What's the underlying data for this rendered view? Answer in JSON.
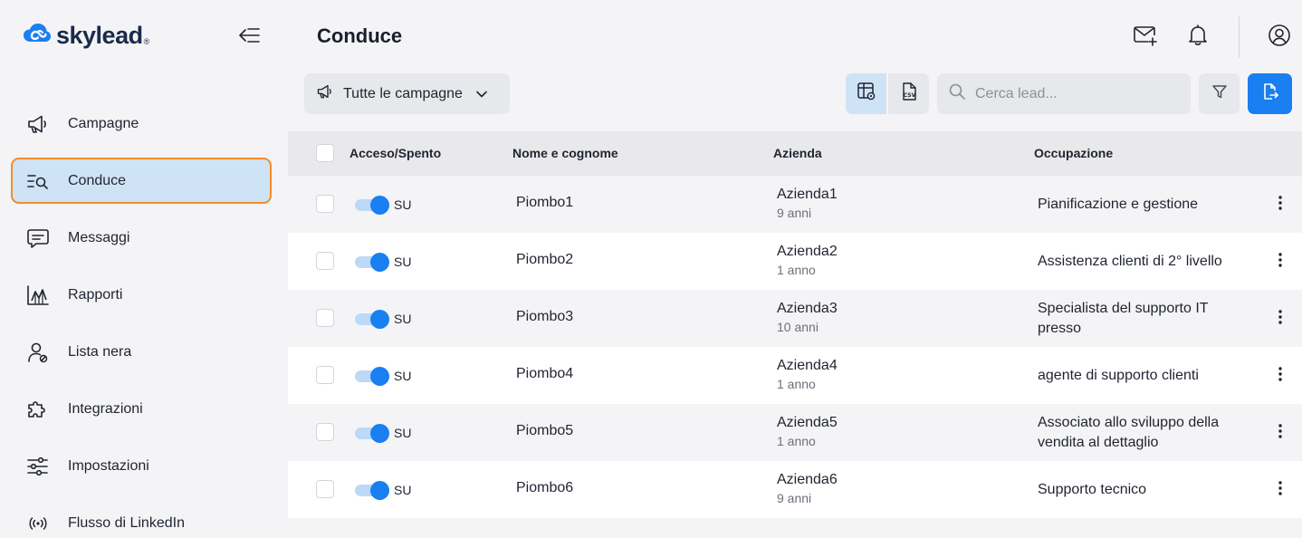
{
  "brand": {
    "name": "skylead",
    "mark": "®",
    "accent": "#1a7ff0"
  },
  "sidebar": {
    "items": [
      {
        "label": "Campagne",
        "icon": "megaphone-icon"
      },
      {
        "label": "Conduce",
        "icon": "leads-search-icon",
        "active": true
      },
      {
        "label": "Messaggi",
        "icon": "message-icon"
      },
      {
        "label": "Rapporti",
        "icon": "chart-icon"
      },
      {
        "label": "Lista nera",
        "icon": "user-block-icon"
      },
      {
        "label": "Integrazioni",
        "icon": "puzzle-icon"
      },
      {
        "label": "Impostazioni",
        "icon": "sliders-icon"
      },
      {
        "label": "Flusso di LinkedIn",
        "icon": "broadcast-icon"
      }
    ]
  },
  "header": {
    "title": "Conduce"
  },
  "toolbar": {
    "campaign_select": "Tutte le campagne",
    "search_placeholder": "Cerca lead..."
  },
  "table": {
    "columns": [
      "Acceso/Spento",
      "Nome e cognome",
      "Azienda",
      "Occupazione"
    ],
    "rows": [
      {
        "toggle": "SU",
        "name": "Piombo1",
        "company": "Azienda1",
        "years": "9 anni",
        "occupation": "Pianificazione e gestione"
      },
      {
        "toggle": "SU",
        "name": "Piombo2",
        "company": "Azienda2",
        "years": "1 anno",
        "occupation": "Assistenza clienti di 2° livello"
      },
      {
        "toggle": "SU",
        "name": "Piombo3",
        "company": "Azienda3",
        "years": "10 anni",
        "occupation": "Specialista del supporto IT presso"
      },
      {
        "toggle": "SU",
        "name": "Piombo4",
        "company": "Azienda4",
        "years": "1 anno",
        "occupation": "agente di supporto clienti"
      },
      {
        "toggle": "SU",
        "name": "Piombo5",
        "company": "Azienda5",
        "years": "1 anno",
        "occupation": "Associato allo sviluppo della vendita al dettaglio"
      },
      {
        "toggle": "SU",
        "name": "Piombo6",
        "company": "Azienda6",
        "years": "9 anni",
        "occupation": "Supporto tecnico"
      }
    ]
  }
}
